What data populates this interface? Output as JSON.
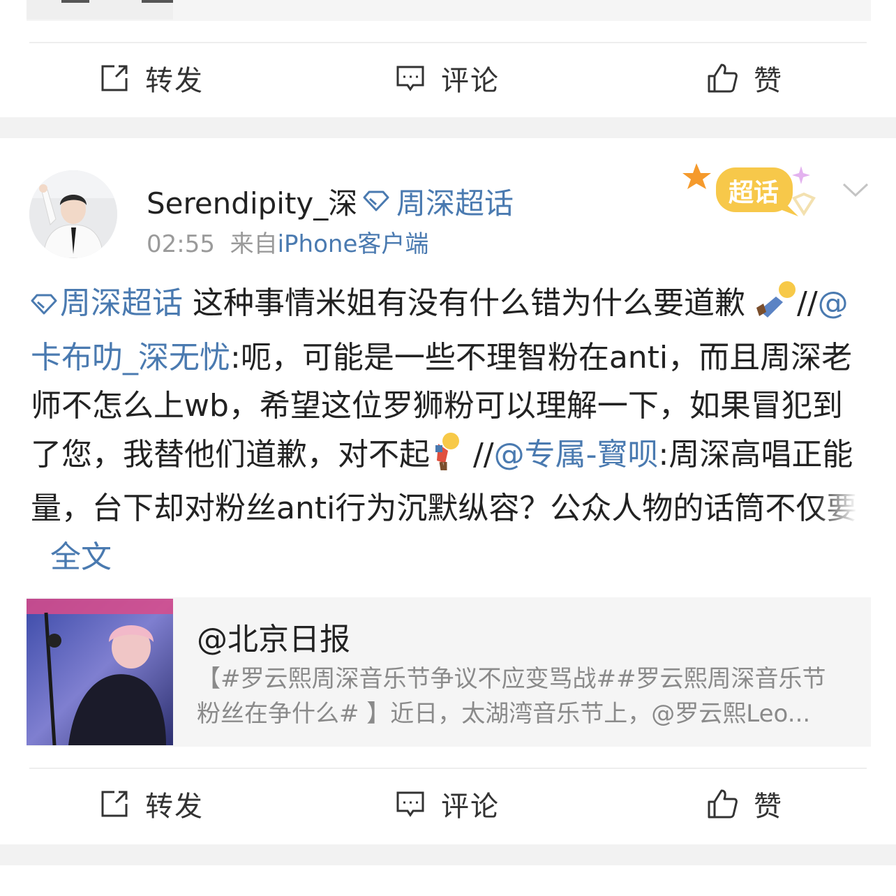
{
  "prev_post": {
    "actions": {
      "repost_label": "转发",
      "comment_label": "评论",
      "like_label": "赞"
    }
  },
  "post": {
    "username": "Serendipity_深",
    "supertopic_tag": "周深超话",
    "time": "02:55",
    "from_prefix": "来自",
    "source": "iPhone客户端",
    "badge_label": "超话",
    "content": {
      "topic_link": "周深超话",
      "text_1": " 这种事情米姐有没有什么错为什么要道歉",
      "repost_sep_1": "//",
      "mention_1": "@卡布叻_深无忧",
      "text_2": ":呃，可能是一些不理智粉在anti，而且周深老师不怎么上wb，希望这位罗狮粉可以理解一下，如果冒犯到了您，我替他们道歉，对不起",
      "repost_sep_2": " //",
      "mention_2": "@专属-寳呗",
      "text_3": ":周深高唱正能量，台下却对粉丝anti行为沉默纵容？公众人物的话筒不仅要",
      "expand_link": "全文"
    },
    "quoted": {
      "author": "@北京日报",
      "text": "【#罗云熙周深音乐节争议不应变骂战##罗云熙周深音乐节粉丝在争什么# 】近日，太湖湾音乐节上，@罗云熙Leo..."
    },
    "actions": {
      "repost_label": "转发",
      "comment_label": "评论",
      "like_label": "赞"
    }
  },
  "colors": {
    "link": "#4a7ab0",
    "secondary_text": "#9a9a9a",
    "badge_yellow": "#f7c84a",
    "separator": "#f2f2f2"
  },
  "icons": {
    "repost": "share-box-icon",
    "comment": "comment-bubble-icon",
    "like": "thumbs-up-icon",
    "supertopic": "diamond-icon",
    "menu": "chevron-down-icon"
  }
}
